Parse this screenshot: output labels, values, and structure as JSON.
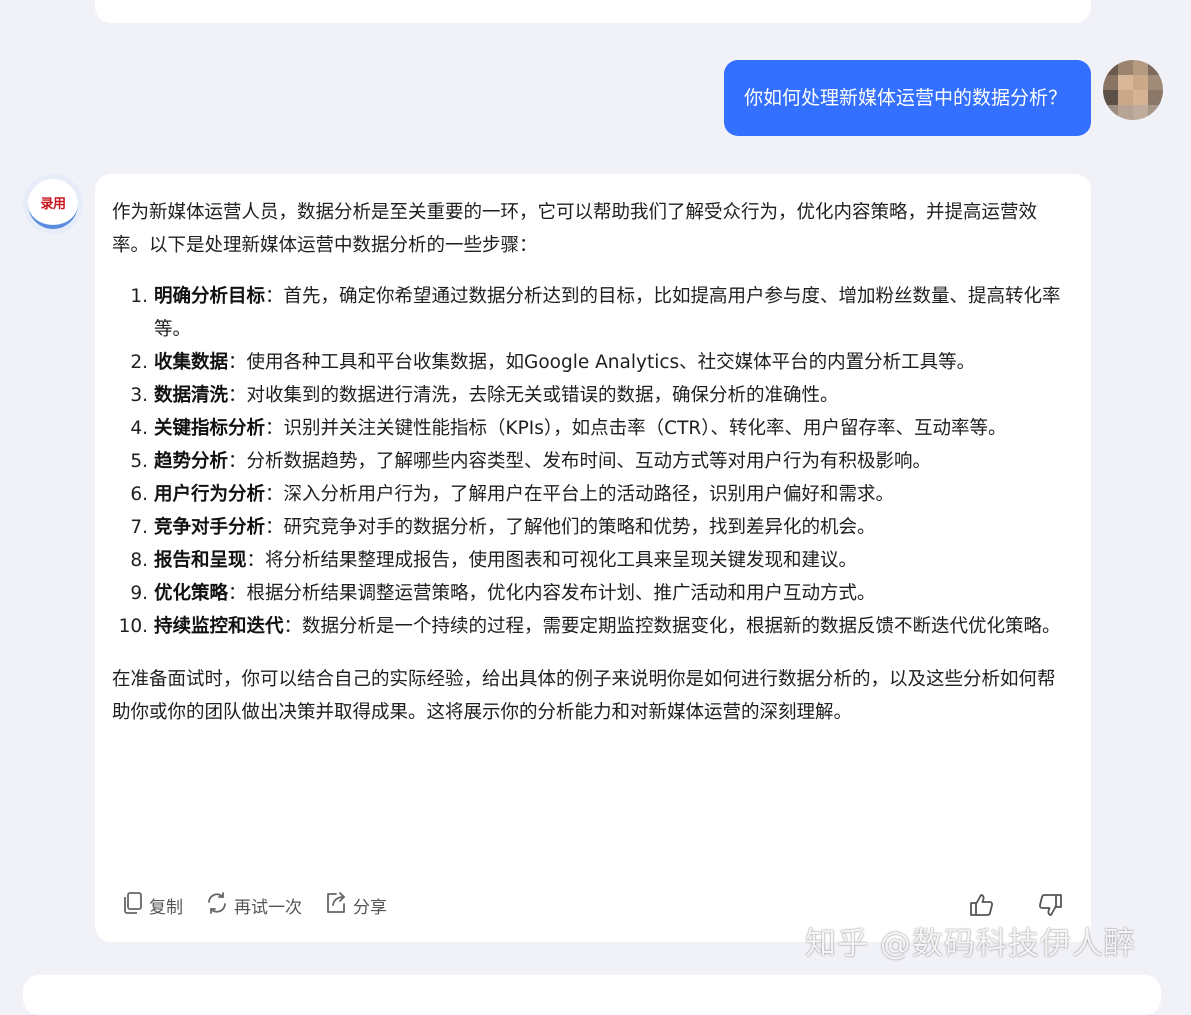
{
  "user_message": {
    "text": "你如何处理新媒体运营中的数据分析？",
    "bubble_color": "#3370ff"
  },
  "bot": {
    "avatar_text": "录用",
    "intro": "作为新媒体运营人员，数据分析是至关重要的一环，它可以帮助我们了解受众行为，优化内容策略，并提高运营效率。以下是处理新媒体运营中数据分析的一些步骤：",
    "steps": [
      {
        "num": "1.",
        "term": "明确分析目标",
        "desc": "：首先，确定你希望通过数据分析达到的目标，比如提高用户参与度、增加粉丝数量、提高转化率等。"
      },
      {
        "num": "2.",
        "term": "收集数据",
        "desc": "：使用各种工具和平台收集数据，如Google Analytics、社交媒体平台的内置分析工具等。"
      },
      {
        "num": "3.",
        "term": "数据清洗",
        "desc": "：对收集到的数据进行清洗，去除无关或错误的数据，确保分析的准确性。"
      },
      {
        "num": "4.",
        "term": "关键指标分析",
        "desc": "：识别并关注关键性能指标（KPIs），如点击率（CTR）、转化率、用户留存率、互动率等。"
      },
      {
        "num": "5.",
        "term": "趋势分析",
        "desc": "：分析数据趋势，了解哪些内容类型、发布时间、互动方式等对用户行为有积极影响。"
      },
      {
        "num": "6.",
        "term": "用户行为分析",
        "desc": "：深入分析用户行为，了解用户在平台上的活动路径，识别用户偏好和需求。"
      },
      {
        "num": "7.",
        "term": "竞争对手分析",
        "desc": "：研究竞争对手的数据分析，了解他们的策略和优势，找到差异化的机会。"
      },
      {
        "num": "8.",
        "term": "报告和呈现",
        "desc": "：将分析结果整理成报告，使用图表和可视化工具来呈现关键发现和建议。"
      },
      {
        "num": "9.",
        "term": "优化策略",
        "desc": "：根据分析结果调整运营策略，优化内容发布计划、推广活动和用户互动方式。"
      },
      {
        "num": "10.",
        "term": "持续监控和迭代",
        "desc": "：数据分析是一个持续的过程，需要定期监控数据变化，根据新的数据反馈不断迭代优化策略。"
      }
    ],
    "conclusion": "在准备面试时，你可以结合自己的实际经验，给出具体的例子来说明你是如何进行数据分析的，以及这些分析如何帮助你或你的团队做出决策并取得成果。这将展示你的分析能力和对新媒体运营的深刻理解。"
  },
  "actions": {
    "copy": "复制",
    "retry": "再试一次",
    "share": "分享"
  },
  "watermark": "知乎 @数码科技伊人醉"
}
